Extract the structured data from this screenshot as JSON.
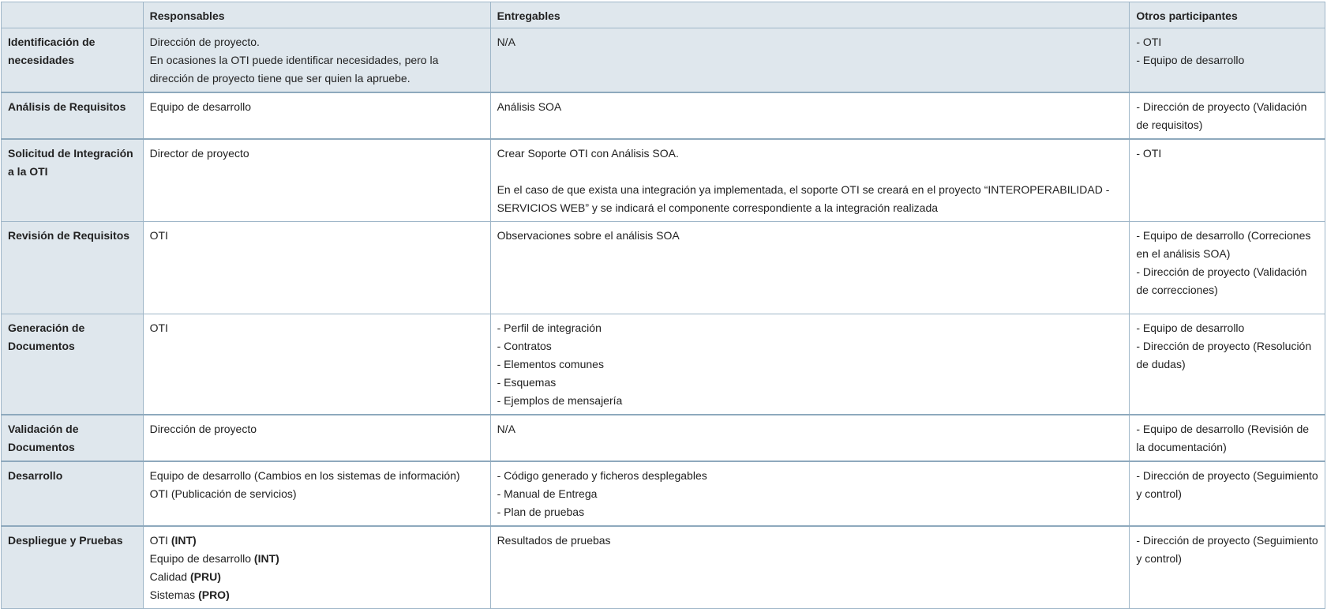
{
  "header": {
    "stage": "",
    "responsables": "Responsables",
    "entregables": "Entregables",
    "otros": "Otros participantes"
  },
  "rows": [
    {
      "stage": "Identificación de necesidades",
      "responsables": [
        "Dirección de proyecto.",
        "En ocasiones la OTI puede identificar necesidades, pero la dirección de proyecto tiene que ser quien la apruebe."
      ],
      "entregables": [
        "N/A"
      ],
      "otros": [
        "- OTI",
        "- Equipo de desarrollo"
      ]
    },
    {
      "stage": "Análisis de Requisitos",
      "responsables": [
        "Equipo de desarrollo"
      ],
      "entregables": [
        "Análisis SOA"
      ],
      "otros": [
        "- Dirección de proyecto (Validación de requisitos)"
      ]
    },
    {
      "stage": "Solicitud de Integración a la OTI",
      "responsables": [
        "Director de proyecto"
      ],
      "entregables": [
        "Crear Soporte OTI con Análisis SOA.",
        "En el caso de que exista una integración ya implementada, el soporte OTI se creará en el proyecto “INTEROPERABILIDAD - SERVICIOS WEB” y se indicará el componente correspondiente a la integración realizada"
      ],
      "otros": [
        "- OTI"
      ]
    },
    {
      "stage": "Revisión de Requisitos",
      "responsables": [
        "OTI"
      ],
      "entregables": [
        "Observaciones sobre el análisis SOA"
      ],
      "otros": [
        "- Equipo de desarrollo (Correciones en el análisis SOA)",
        "- Dirección de proyecto (Validación de correcciones)"
      ]
    },
    {
      "stage": "Generación de Documentos",
      "responsables": [
        "OTI"
      ],
      "entregables": [
        "- Perfil de integración",
        "- Contratos",
        "- Elementos comunes",
        "- Esquemas",
        "- Ejemplos de mensajería"
      ],
      "otros": [
        "- Equipo de desarrollo",
        "- Dirección de proyecto (Resolución de dudas)"
      ]
    },
    {
      "stage": "Validación de Documentos",
      "responsables": [
        "Dirección de proyecto"
      ],
      "entregables": [
        "N/A"
      ],
      "otros": [
        "- Equipo de desarrollo (Revisión de la documentación)"
      ]
    },
    {
      "stage": "Desarrollo",
      "responsables": [
        "Equipo de desarrollo (Cambios en los sistemas de información)",
        "OTI (Publicación de servicios)"
      ],
      "entregables": [
        "- Código generado y ficheros desplegables",
        "- Manual de Entrega",
        "- Plan de pruebas"
      ],
      "otros": [
        "- Dirección de proyecto (Seguimiento y control)"
      ]
    },
    {
      "stage": "Despliegue y Pruebas",
      "responsables": [
        {
          "who": "OTI",
          "env": "(INT)"
        },
        {
          "who": "Equipo de desarrollo",
          "env": "(INT)"
        },
        {
          "who": "Calidad",
          "env": "(PRU)"
        },
        {
          "who": "Sistemas",
          "env": "(PRO)"
        }
      ],
      "entregables": [
        "Resultados de pruebas"
      ],
      "otros": [
        "- Dirección de proyecto (Seguimiento y control)"
      ]
    }
  ],
  "colors": {
    "header_bg": "#dfe7ed",
    "border": "#9fb6c8",
    "text": "#222222"
  }
}
